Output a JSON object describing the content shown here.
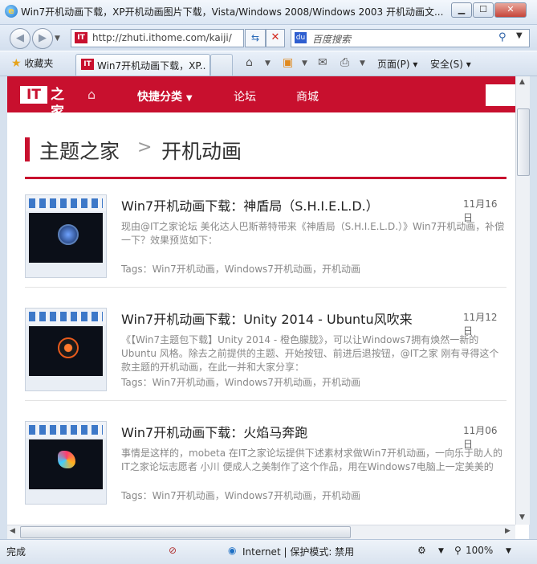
{
  "window": {
    "title": "Win7开机动画下载，XP开机动画图片下载，Vista/Windows 2008/Windows 2003 开机动画文..."
  },
  "address_bar": {
    "url": "http://zhuti.ithome.com/kaiji/",
    "search_placeholder": "百度搜索"
  },
  "toolbar": {
    "favorites_label": "收藏夹",
    "tab_label": "Win7开机动画下载，XP...",
    "page_menu": "页面(P)",
    "safety_menu": "安全(S)"
  },
  "site": {
    "logo_it": "IT",
    "logo_rest": "之家",
    "nav": {
      "quick_category": "快捷分类",
      "forum": "论坛",
      "mall": "商城"
    },
    "breadcrumb": {
      "home": "主题之家",
      "separator": ">",
      "current": "开机动画"
    }
  },
  "articles": [
    {
      "title": "Win7开机动画下载：神盾局（S.H.I.E.L.D.）",
      "date": "11月16日",
      "excerpt": "现由@IT之家论坛 美化达人巴斯蒂特带来《神盾局（S.H.I.E.L.D.）》Win7开机动画，补偿一下？效果预览如下：",
      "tags": "Tags：Win7开机动画，Windows7开机动画，开机动画"
    },
    {
      "title": "Win7开机动画下载：Unity 2014 - Ubuntu风吹来",
      "date": "11月12日",
      "excerpt": "《【Win7主题包下载】Unity 2014 - 橙色朦胧》，可以让Windows7拥有焕然一新的 Ubuntu 风格。除去之前提供的主题、开始按钮、前进后退按钮，@IT之家 刚有寻得这个款主题的开机动画，在此一并和大家分享：",
      "tags": "Tags：Win7开机动画，Windows7开机动画，开机动画"
    },
    {
      "title": "Win7开机动画下载：火焰马奔跑",
      "date": "11月06日",
      "excerpt": "事情是这样的，mobeta 在IT之家论坛提供下述素材求做Win7开机动画，一向乐于助人的IT之家论坛志愿者 小川 便成人之美制作了这个作品，用在Windows7电脑上一定美美的",
      "tags": "Tags：Win7开机动画，Windows7开机动画，开机动画"
    }
  ],
  "statusbar": {
    "status": "完成",
    "zone": "Internet | 保护模式: 禁用",
    "zoom": "100%"
  },
  "colors": {
    "brand_red": "#c8102e"
  }
}
